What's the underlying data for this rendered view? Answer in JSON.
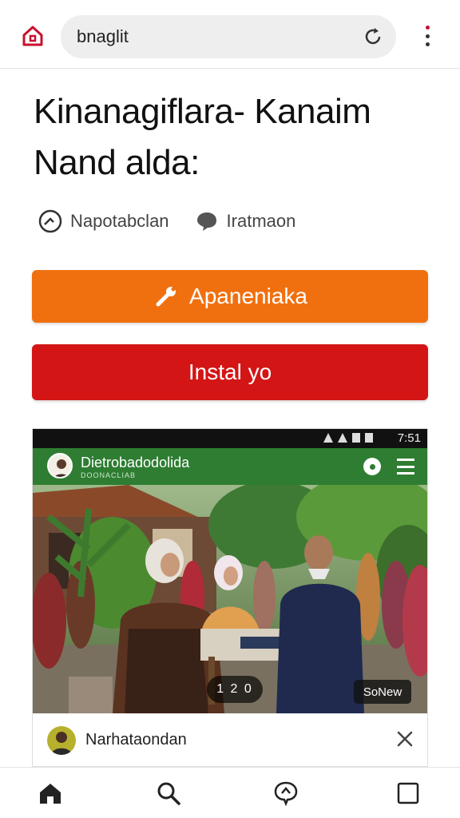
{
  "browser": {
    "url_text": "bnaglit",
    "home_icon": "home-icon",
    "reload_icon": "reload-icon",
    "menu_icon": "kebab-menu-icon",
    "accent": "#c8102e"
  },
  "article": {
    "title_line1": "Kinanagiflara- Kanaim",
    "title_line2": "Nand alda:",
    "meta": [
      {
        "icon": "gauge-icon",
        "label": "Napotabclan"
      },
      {
        "icon": "comment-icon",
        "label": "Iratmaon"
      }
    ]
  },
  "buttons": {
    "primary_label": "Apaneniaka",
    "primary_icon": "wrench-icon",
    "primary_color": "#f07010",
    "secondary_label": "Instal yo",
    "secondary_color": "#d31515"
  },
  "embedded_app": {
    "status_clock": "7:51",
    "header_title": "Dietrobadodolida",
    "header_subtitle": "DOONACLIAB",
    "header_color": "#2e7d32",
    "video_counter": "1 2 0",
    "video_button": "SoNew",
    "footer_name": "Narhataondan",
    "close_icon": "close-icon"
  },
  "bottom_nav": [
    {
      "icon": "home-icon"
    },
    {
      "icon": "search-icon"
    },
    {
      "icon": "chat-icon"
    },
    {
      "icon": "tabs-icon"
    }
  ]
}
